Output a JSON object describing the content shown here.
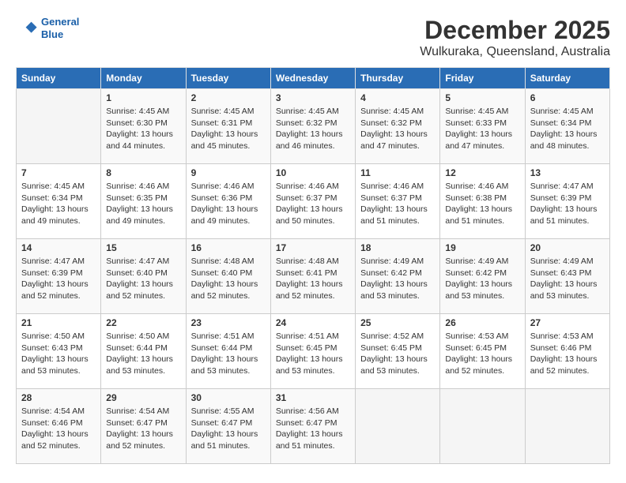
{
  "logo": {
    "line1": "General",
    "line2": "Blue"
  },
  "title": "December 2025",
  "subtitle": "Wulkuraka, Queensland, Australia",
  "headers": [
    "Sunday",
    "Monday",
    "Tuesday",
    "Wednesday",
    "Thursday",
    "Friday",
    "Saturday"
  ],
  "weeks": [
    [
      {
        "day": "",
        "sunrise": "",
        "sunset": "",
        "daylight": ""
      },
      {
        "day": "1",
        "sunrise": "Sunrise: 4:45 AM",
        "sunset": "Sunset: 6:30 PM",
        "daylight": "Daylight: 13 hours and 44 minutes."
      },
      {
        "day": "2",
        "sunrise": "Sunrise: 4:45 AM",
        "sunset": "Sunset: 6:31 PM",
        "daylight": "Daylight: 13 hours and 45 minutes."
      },
      {
        "day": "3",
        "sunrise": "Sunrise: 4:45 AM",
        "sunset": "Sunset: 6:32 PM",
        "daylight": "Daylight: 13 hours and 46 minutes."
      },
      {
        "day": "4",
        "sunrise": "Sunrise: 4:45 AM",
        "sunset": "Sunset: 6:32 PM",
        "daylight": "Daylight: 13 hours and 47 minutes."
      },
      {
        "day": "5",
        "sunrise": "Sunrise: 4:45 AM",
        "sunset": "Sunset: 6:33 PM",
        "daylight": "Daylight: 13 hours and 47 minutes."
      },
      {
        "day": "6",
        "sunrise": "Sunrise: 4:45 AM",
        "sunset": "Sunset: 6:34 PM",
        "daylight": "Daylight: 13 hours and 48 minutes."
      }
    ],
    [
      {
        "day": "7",
        "sunrise": "Sunrise: 4:45 AM",
        "sunset": "Sunset: 6:34 PM",
        "daylight": "Daylight: 13 hours and 49 minutes."
      },
      {
        "day": "8",
        "sunrise": "Sunrise: 4:46 AM",
        "sunset": "Sunset: 6:35 PM",
        "daylight": "Daylight: 13 hours and 49 minutes."
      },
      {
        "day": "9",
        "sunrise": "Sunrise: 4:46 AM",
        "sunset": "Sunset: 6:36 PM",
        "daylight": "Daylight: 13 hours and 49 minutes."
      },
      {
        "day": "10",
        "sunrise": "Sunrise: 4:46 AM",
        "sunset": "Sunset: 6:37 PM",
        "daylight": "Daylight: 13 hours and 50 minutes."
      },
      {
        "day": "11",
        "sunrise": "Sunrise: 4:46 AM",
        "sunset": "Sunset: 6:37 PM",
        "daylight": "Daylight: 13 hours and 51 minutes."
      },
      {
        "day": "12",
        "sunrise": "Sunrise: 4:46 AM",
        "sunset": "Sunset: 6:38 PM",
        "daylight": "Daylight: 13 hours and 51 minutes."
      },
      {
        "day": "13",
        "sunrise": "Sunrise: 4:47 AM",
        "sunset": "Sunset: 6:39 PM",
        "daylight": "Daylight: 13 hours and 51 minutes."
      }
    ],
    [
      {
        "day": "14",
        "sunrise": "Sunrise: 4:47 AM",
        "sunset": "Sunset: 6:39 PM",
        "daylight": "Daylight: 13 hours and 52 minutes."
      },
      {
        "day": "15",
        "sunrise": "Sunrise: 4:47 AM",
        "sunset": "Sunset: 6:40 PM",
        "daylight": "Daylight: 13 hours and 52 minutes."
      },
      {
        "day": "16",
        "sunrise": "Sunrise: 4:48 AM",
        "sunset": "Sunset: 6:40 PM",
        "daylight": "Daylight: 13 hours and 52 minutes."
      },
      {
        "day": "17",
        "sunrise": "Sunrise: 4:48 AM",
        "sunset": "Sunset: 6:41 PM",
        "daylight": "Daylight: 13 hours and 52 minutes."
      },
      {
        "day": "18",
        "sunrise": "Sunrise: 4:49 AM",
        "sunset": "Sunset: 6:42 PM",
        "daylight": "Daylight: 13 hours and 53 minutes."
      },
      {
        "day": "19",
        "sunrise": "Sunrise: 4:49 AM",
        "sunset": "Sunset: 6:42 PM",
        "daylight": "Daylight: 13 hours and 53 minutes."
      },
      {
        "day": "20",
        "sunrise": "Sunrise: 4:49 AM",
        "sunset": "Sunset: 6:43 PM",
        "daylight": "Daylight: 13 hours and 53 minutes."
      }
    ],
    [
      {
        "day": "21",
        "sunrise": "Sunrise: 4:50 AM",
        "sunset": "Sunset: 6:43 PM",
        "daylight": "Daylight: 13 hours and 53 minutes."
      },
      {
        "day": "22",
        "sunrise": "Sunrise: 4:50 AM",
        "sunset": "Sunset: 6:44 PM",
        "daylight": "Daylight: 13 hours and 53 minutes."
      },
      {
        "day": "23",
        "sunrise": "Sunrise: 4:51 AM",
        "sunset": "Sunset: 6:44 PM",
        "daylight": "Daylight: 13 hours and 53 minutes."
      },
      {
        "day": "24",
        "sunrise": "Sunrise: 4:51 AM",
        "sunset": "Sunset: 6:45 PM",
        "daylight": "Daylight: 13 hours and 53 minutes."
      },
      {
        "day": "25",
        "sunrise": "Sunrise: 4:52 AM",
        "sunset": "Sunset: 6:45 PM",
        "daylight": "Daylight: 13 hours and 53 minutes."
      },
      {
        "day": "26",
        "sunrise": "Sunrise: 4:53 AM",
        "sunset": "Sunset: 6:45 PM",
        "daylight": "Daylight: 13 hours and 52 minutes."
      },
      {
        "day": "27",
        "sunrise": "Sunrise: 4:53 AM",
        "sunset": "Sunset: 6:46 PM",
        "daylight": "Daylight: 13 hours and 52 minutes."
      }
    ],
    [
      {
        "day": "28",
        "sunrise": "Sunrise: 4:54 AM",
        "sunset": "Sunset: 6:46 PM",
        "daylight": "Daylight: 13 hours and 52 minutes."
      },
      {
        "day": "29",
        "sunrise": "Sunrise: 4:54 AM",
        "sunset": "Sunset: 6:47 PM",
        "daylight": "Daylight: 13 hours and 52 minutes."
      },
      {
        "day": "30",
        "sunrise": "Sunrise: 4:55 AM",
        "sunset": "Sunset: 6:47 PM",
        "daylight": "Daylight: 13 hours and 51 minutes."
      },
      {
        "day": "31",
        "sunrise": "Sunrise: 4:56 AM",
        "sunset": "Sunset: 6:47 PM",
        "daylight": "Daylight: 13 hours and 51 minutes."
      },
      {
        "day": "",
        "sunrise": "",
        "sunset": "",
        "daylight": ""
      },
      {
        "day": "",
        "sunrise": "",
        "sunset": "",
        "daylight": ""
      },
      {
        "day": "",
        "sunrise": "",
        "sunset": "",
        "daylight": ""
      }
    ]
  ]
}
